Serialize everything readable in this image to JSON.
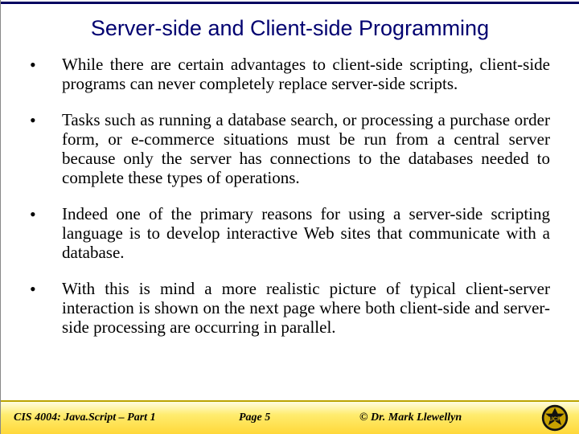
{
  "title": "Server-side and Client-side Programming",
  "bullets": [
    "While there are certain advantages to client-side scripting, client-side programs can never completely replace server-side scripts.",
    "Tasks such as running a database search, or processing a purchase order form, or e-commerce situations must be run from a central server because only the server has connections to the databases needed to complete these types of operations.",
    "Indeed one of the primary reasons for using a server-side scripting language is to develop interactive Web sites that communicate with a database.",
    "With this is mind a more realistic picture of typical client-server interaction is shown on the next page where both client-side and server-side processing are occurring in parallel."
  ],
  "footer": {
    "course": "CIS 4004: Java.Script – Part 1",
    "page": "Page 5",
    "copyright": "© Dr. Mark Llewellyn"
  }
}
